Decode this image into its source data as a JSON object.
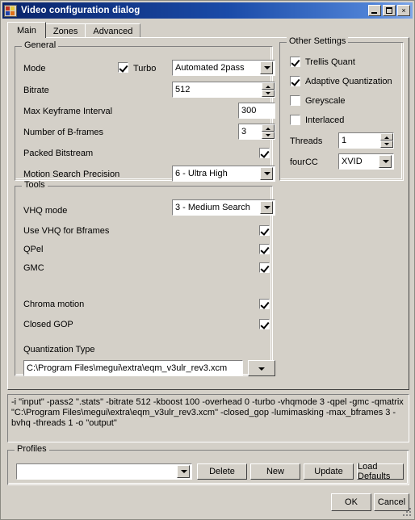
{
  "window": {
    "title": "Video configuration dialog",
    "icon": "app-icon",
    "buttons": {
      "minimize": "minimize-icon",
      "maximize": "maximize-icon",
      "close": "×"
    }
  },
  "tabs": [
    {
      "label": "Main",
      "active": true
    },
    {
      "label": "Zones",
      "active": false
    },
    {
      "label": "Advanced",
      "active": false
    }
  ],
  "general": {
    "legend": "General",
    "mode_label": "Mode",
    "turbo_label": "Turbo",
    "turbo_checked": true,
    "mode_value": "Automated 2pass",
    "bitrate_label": "Bitrate",
    "bitrate_value": "512",
    "max_keyframe_label": "Max Keyframe Interval",
    "max_keyframe_value": "300",
    "bframes_label": "Number of B-frames",
    "bframes_value": "3",
    "packed_bitstream_label": "Packed Bitstream",
    "packed_bitstream_checked": true,
    "motion_search_label": "Motion Search Precision",
    "motion_search_value": "6 - Ultra High"
  },
  "other_settings": {
    "legend": "Other Settings",
    "trellis_label": "Trellis Quant",
    "trellis_checked": true,
    "adaptive_label": "Adaptive Quantization",
    "adaptive_checked": true,
    "greyscale_label": "Greyscale",
    "greyscale_checked": false,
    "interlaced_label": "Interlaced",
    "interlaced_checked": false,
    "threads_label": "Threads",
    "threads_value": "1",
    "fourcc_label": "fourCC",
    "fourcc_value": "XVID"
  },
  "tools": {
    "legend": "Tools",
    "vhq_mode_label": "VHQ mode",
    "vhq_mode_value": "3 - Medium Search",
    "use_vhq_bframes_label": "Use VHQ for Bframes",
    "use_vhq_bframes_checked": true,
    "qpel_label": "QPel",
    "qpel_checked": true,
    "gmc_label": "GMC",
    "gmc_checked": true,
    "chroma_motion_label": "Chroma motion",
    "chroma_motion_checked": true,
    "closed_gop_label": "Closed GOP",
    "closed_gop_checked": true,
    "quant_type_label": "Quantization Type",
    "quant_type_value": "C:\\Program Files\\megui\\extra\\eqm_v3ulr_rev3.xcm"
  },
  "command_line": {
    "text": "-i \"input\" -pass2 \".stats\" -bitrate 512 -kboost 100 -overhead 0 -turbo -vhqmode 3 -qpel -gmc -qmatrix \"C:\\Program Files\\megui\\extra\\eqm_v3ulr_rev3.xcm\" -closed_gop -lumimasking -max_bframes 3 -bvhq -threads 1  -o \"output\""
  },
  "profiles": {
    "legend": "Profiles",
    "selected": "",
    "delete_label": "Delete",
    "new_label": "New",
    "update_label": "Update",
    "load_defaults_label": "Load Defaults"
  },
  "footer": {
    "ok_label": "OK",
    "cancel_label": "Cancel"
  }
}
